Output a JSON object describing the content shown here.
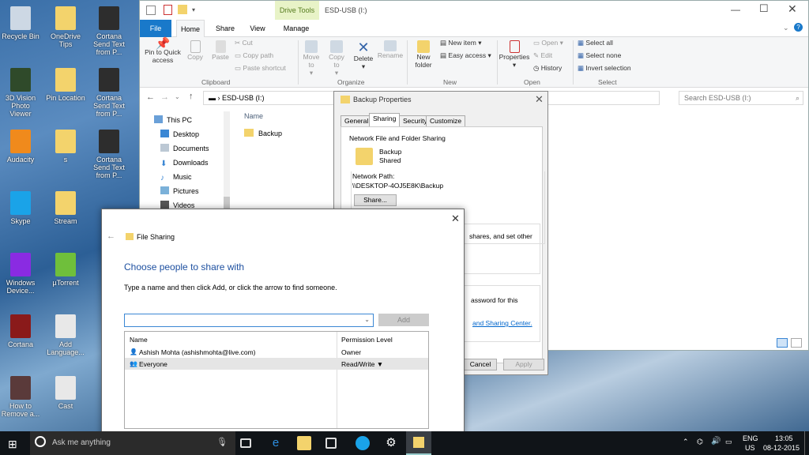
{
  "desktop": {
    "icons": [
      {
        "label": "Recycle Bin",
        "color": "#cdd8e4"
      },
      {
        "label": "OneDrive Tips",
        "color": "#f3d36c"
      },
      {
        "label": "Cortana Send Text from P...",
        "color": "#2d2d2d"
      },
      {
        "label": "3D Vision Photo Viewer",
        "color": "#2f4a2a"
      },
      {
        "label": "Pin Location",
        "color": "#f3d36c"
      },
      {
        "label": "Cortana Send Text from P...",
        "color": "#2d2d2d"
      },
      {
        "label": "Audacity",
        "color": "#f08a1c"
      },
      {
        "label": "s",
        "color": "#f3d36c"
      },
      {
        "label": "Cortana Send Text from P...",
        "color": "#2d2d2d"
      },
      {
        "label": "Skype",
        "color": "#1aa3e8"
      },
      {
        "label": "Stream",
        "color": "#f3d36c"
      },
      {
        "label": "Windows Device...",
        "color": "#8a2be2"
      },
      {
        "label": "µTorrent",
        "color": "#6fbf3b"
      },
      {
        "label": "Cortana",
        "color": "#8a1a1a"
      },
      {
        "label": "Add Language...",
        "color": "#e8e8e8"
      },
      {
        "label": "How to Remove a...",
        "color": "#5a3a3a"
      },
      {
        "label": "Cast",
        "color": "#e8e8e8"
      }
    ]
  },
  "explorer": {
    "title": "ESD-USB (I:)",
    "drive_tools": "Drive Tools",
    "tabs": [
      "File",
      "Home",
      "Share",
      "View",
      "Manage"
    ],
    "ribbon": {
      "pin": "Pin to Quick access",
      "copy": "Copy",
      "paste": "Paste",
      "cut": "Cut",
      "copy_path": "Copy path",
      "paste_shortcut": "Paste shortcut",
      "clipboard": "Clipboard",
      "move_to": "Move to",
      "copy_to": "Copy to",
      "delete": "Delete",
      "rename": "Rename",
      "organize": "Organize",
      "new_folder": "New folder",
      "new_item": "New item",
      "easy_access": "Easy access",
      "new": "New",
      "properties": "Properties",
      "open": "Open",
      "edit": "Edit",
      "history": "History",
      "open_group": "Open",
      "select_all": "Select all",
      "select_none": "Select none",
      "invert": "Invert selection",
      "select": "Select"
    },
    "address": "ESD-USB (I:)",
    "search_placeholder": "Search ESD-USB (I:)",
    "nav": [
      "This PC",
      "Desktop",
      "Documents",
      "Downloads",
      "Music",
      "Pictures",
      "Videos"
    ],
    "column_name": "Name",
    "files": [
      "Backup"
    ]
  },
  "props": {
    "title": "Backup Properties",
    "tabs": [
      "General",
      "Sharing",
      "Security",
      "Customize"
    ],
    "section": "Network File and Folder Sharing",
    "folder": "Backup",
    "state": "Shared",
    "path_label": "Network Path:",
    "path": "\\\\DESKTOP-4OJ5E8K\\Backup",
    "share_btn": "Share...",
    "frag1": "shares, and set other",
    "frag2": "assword for this",
    "frag3": "and Sharing Center.",
    "cancel": "Cancel",
    "apply": "Apply"
  },
  "share": {
    "title": "File Sharing",
    "heading": "Choose people to share with",
    "instruction": "Type a name and then click Add, or click the arrow to find someone.",
    "add": "Add",
    "col_name": "Name",
    "col_perm": "Permission Level",
    "rows": [
      {
        "name": "Ashish Mohta (ashishmohta@live.com)",
        "perm": "Owner"
      },
      {
        "name": "Everyone",
        "perm": "Read/Write ▼"
      }
    ]
  },
  "taskbar": {
    "search": "Ask me anything",
    "lang": "ENG",
    "region": "US",
    "time": "13:05",
    "date": "08-12-2015"
  }
}
